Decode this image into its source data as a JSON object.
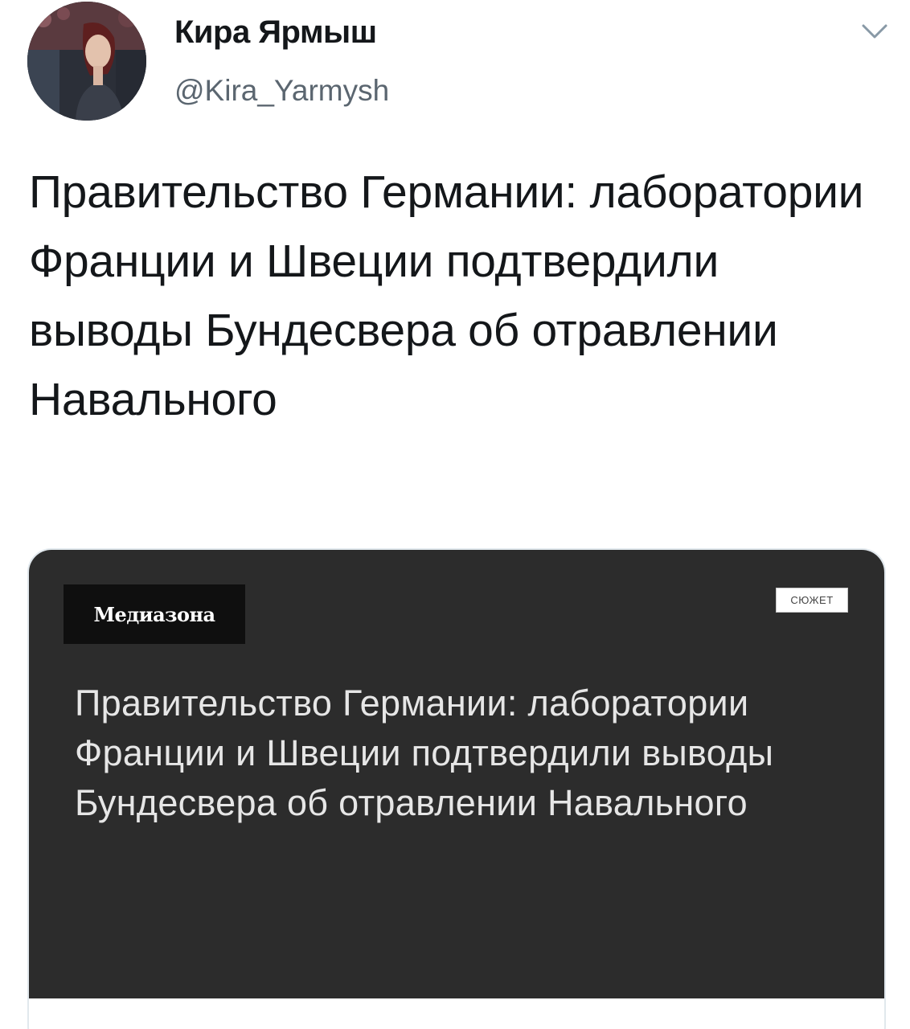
{
  "tweet": {
    "display_name": "Кира Ярмыш",
    "handle": "@Kira_Yarmysh",
    "text": "Правительство Германии: лаборатории Франции и Швеции подтвердили выводы Бундесвера об отравлении Навального"
  },
  "card": {
    "brand": "Медиазона",
    "tag": "СЮЖЕТ",
    "headline": "Правительство Германии: лаборатории Франции и Швеции подтвердили выводы Бундесвера об отравлении Навального"
  },
  "icons": {
    "avatar": "user-avatar",
    "menu": "chevron-down-icon"
  },
  "colors": {
    "card_background": "#2c2c2c",
    "brand_box": "#0f0f0f",
    "handle_text": "#5b6670"
  }
}
